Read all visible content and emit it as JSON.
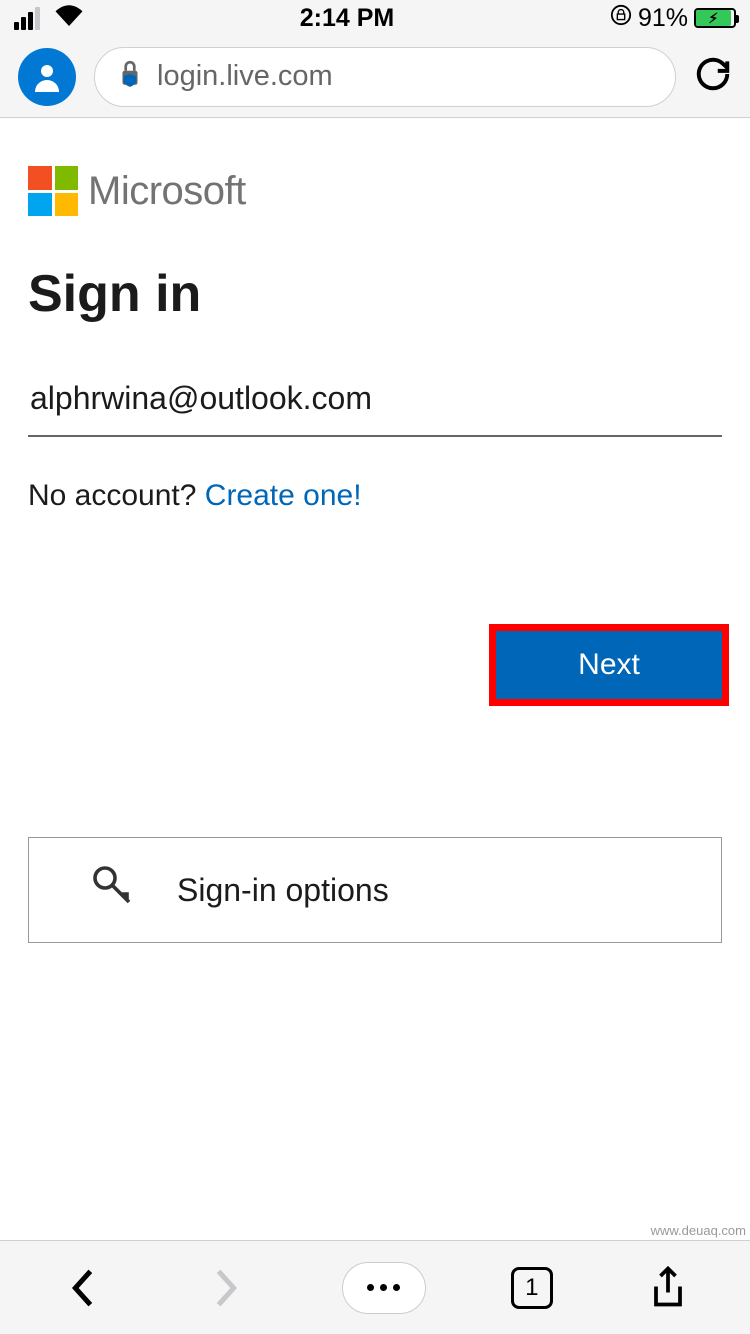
{
  "status_bar": {
    "time": "2:14 PM",
    "battery_percent": "91%"
  },
  "browser": {
    "url": "login.live.com",
    "tab_count": "1"
  },
  "page": {
    "brand": "Microsoft",
    "title": "Sign in",
    "email_value": "alphrwina@outlook.com",
    "no_account_text": "No account? ",
    "create_one_text": "Create one!",
    "next_label": "Next",
    "signin_options_label": "Sign-in options"
  },
  "watermark": "www.deuaq.com"
}
